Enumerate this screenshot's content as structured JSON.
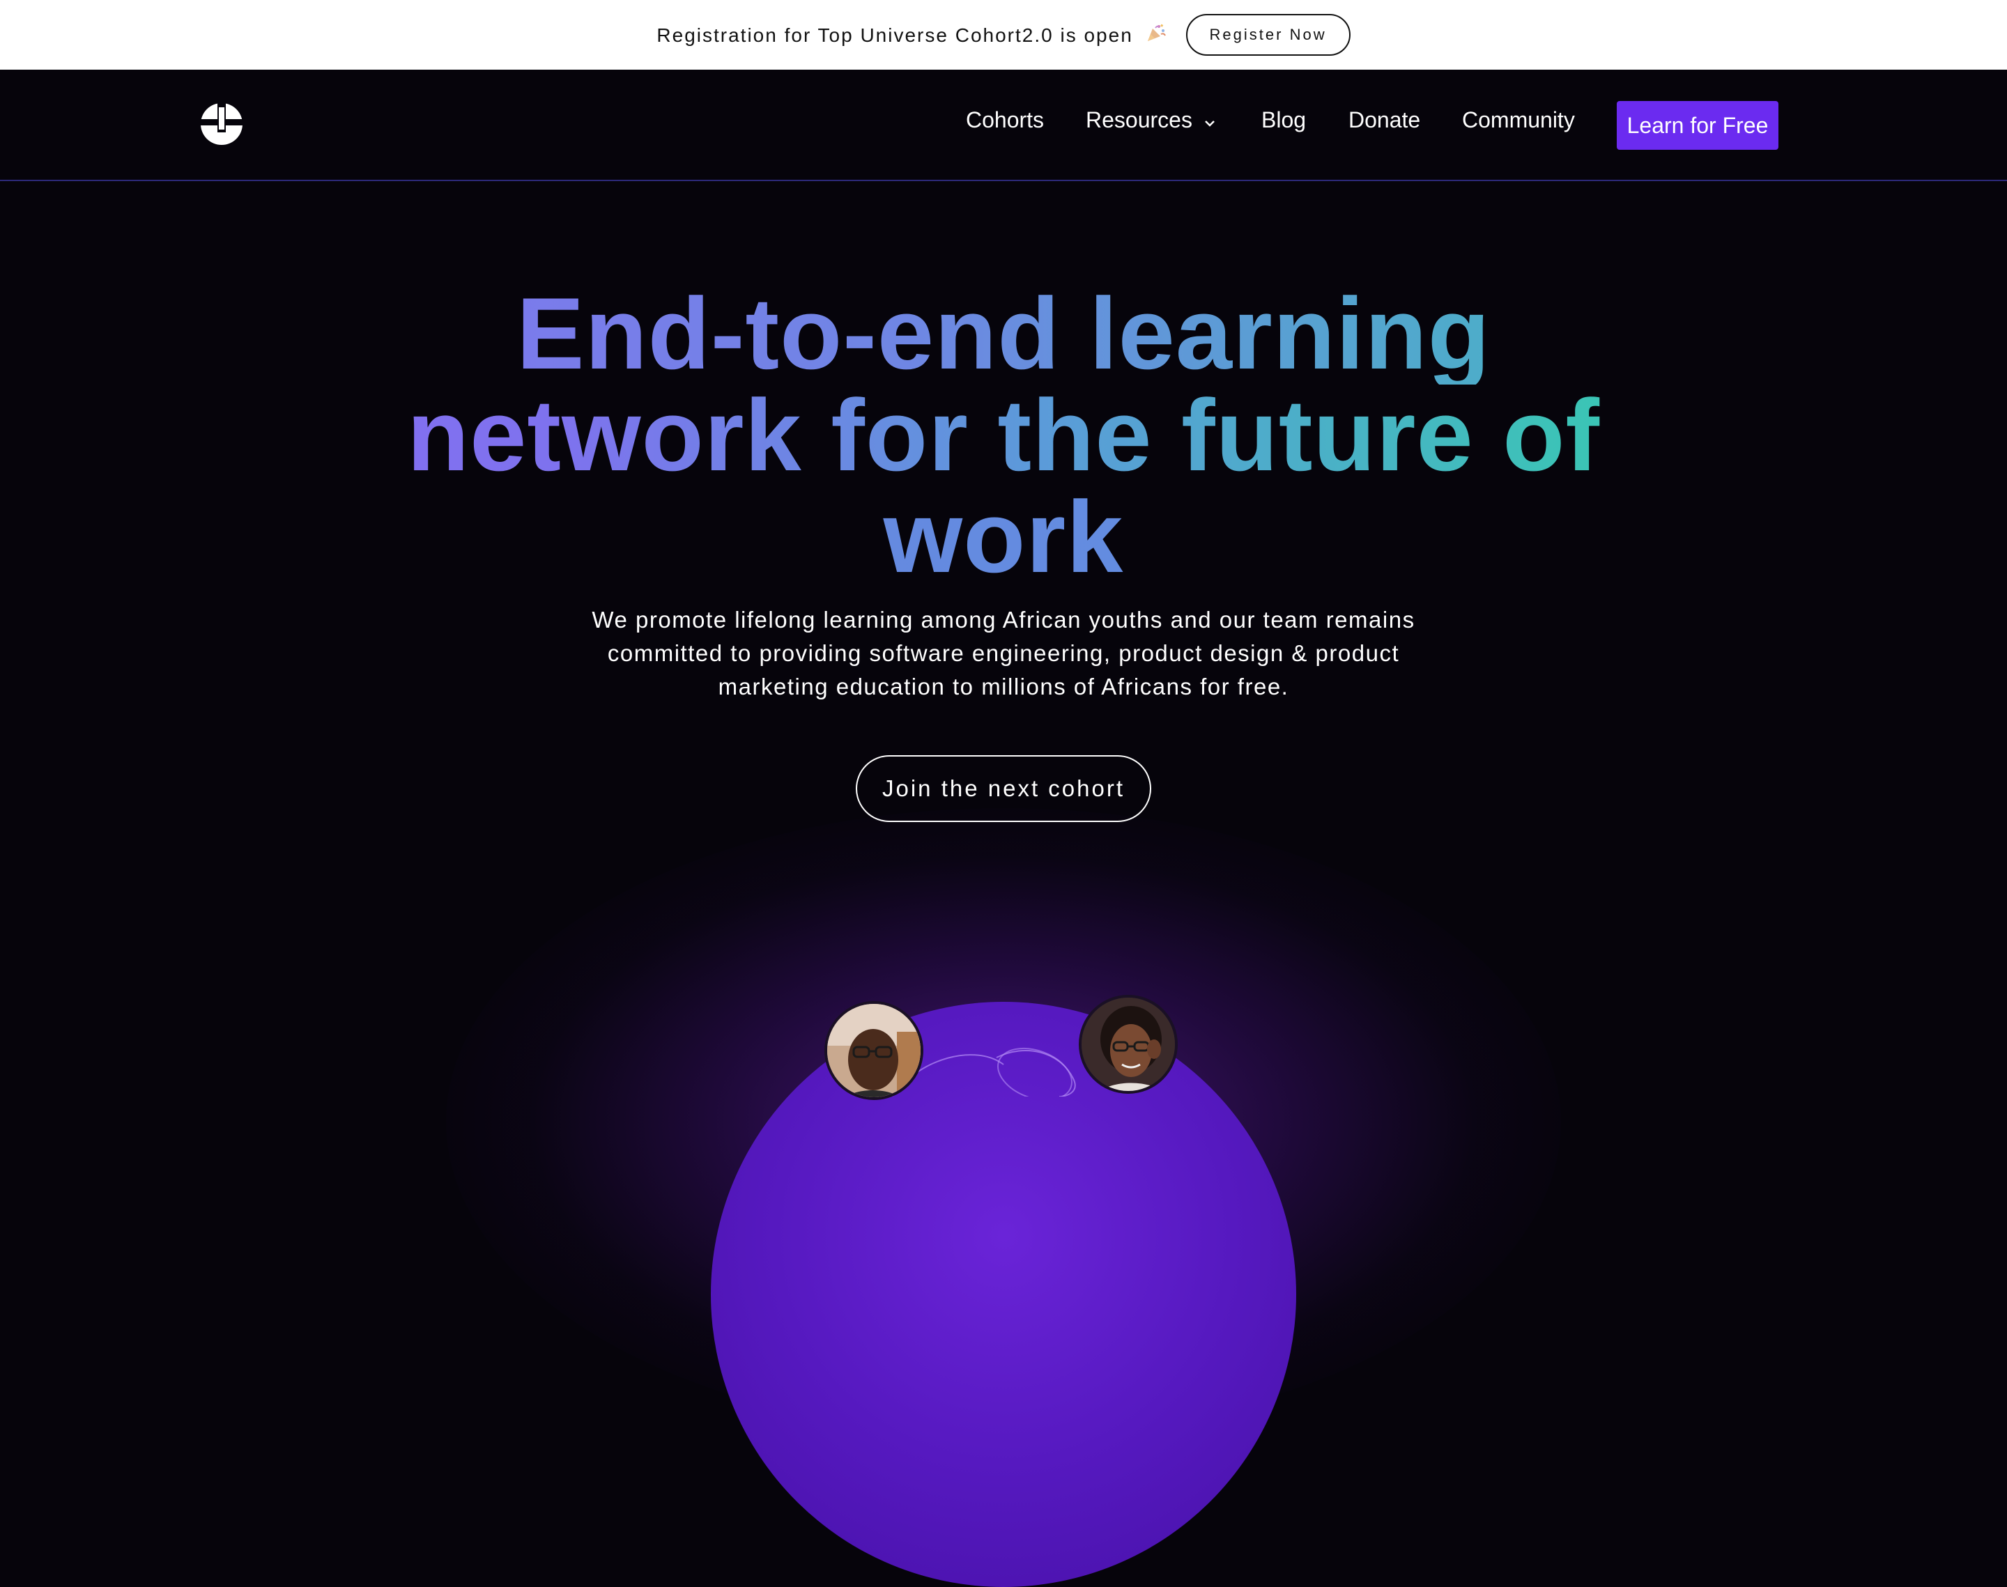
{
  "announcement": {
    "text": "Registration for Top Universe Cohort2.0 is open",
    "icon": "party-popper-icon",
    "button_label": "Register Now"
  },
  "nav": {
    "logo": "top-universe-logo",
    "items": [
      {
        "label": "Cohorts"
      },
      {
        "label": "Resources",
        "has_dropdown": true
      },
      {
        "label": "Blog"
      },
      {
        "label": "Donate"
      },
      {
        "label": "Community"
      }
    ],
    "cta_label": "Learn for Free"
  },
  "hero": {
    "title_line1": "End-to-end learning",
    "title_line2": "network for the future of",
    "title_line3": "work",
    "subtitle_line1": "We promote lifelong learning among African youths and our team remains",
    "subtitle_line2": "committed to providing software engineering, product design & product",
    "subtitle_line3": "marketing education to millions of Africans for free.",
    "cta_label": "Join the next cohort"
  },
  "colors": {
    "background": "#06040b",
    "accent": "#6b2bf0",
    "gradient_start": "#8a6cf5",
    "gradient_end": "#2fd0a5",
    "orb": "#5619c0"
  }
}
